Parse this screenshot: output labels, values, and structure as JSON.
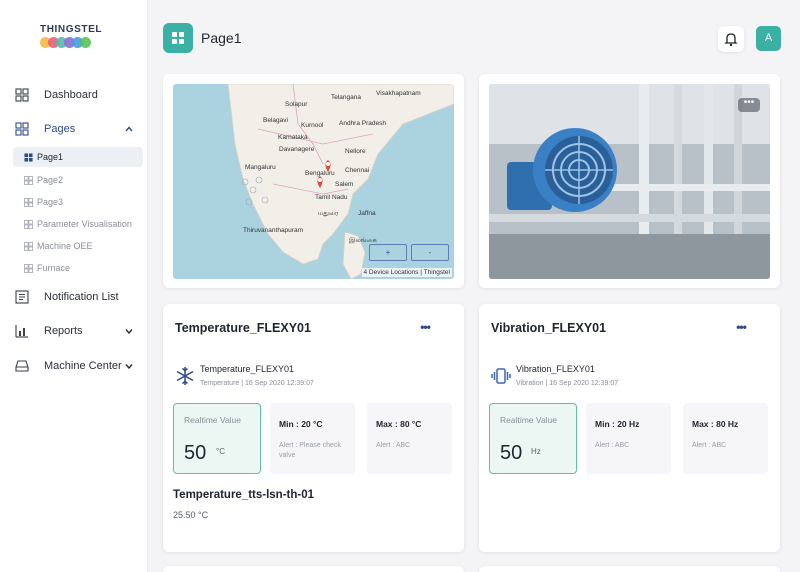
{
  "brand": {
    "name": "THINGSTEL",
    "dot_colors": [
      "#f5b942",
      "#e8617a",
      "#55b8a9",
      "#8d6bd0",
      "#4a9be0",
      "#5ac05a"
    ]
  },
  "sidebar": {
    "items": [
      {
        "label": "Dashboard",
        "icon": "grid-icon"
      },
      {
        "label": "Pages",
        "icon": "grid-icon",
        "expanded": true
      },
      {
        "label": "Notification List",
        "icon": "list-icon"
      },
      {
        "label": "Reports",
        "icon": "bar-chart-icon"
      },
      {
        "label": "Machine Center",
        "icon": "tray-icon"
      }
    ],
    "pages": [
      {
        "label": "Page1",
        "active": true
      },
      {
        "label": "Page2"
      },
      {
        "label": "Page3"
      },
      {
        "label": "Parameter Visualisation"
      },
      {
        "label": "Machine OEE"
      },
      {
        "label": "Furnace"
      }
    ]
  },
  "header": {
    "title": "Page1",
    "avatar_initial": "A"
  },
  "map": {
    "attribution": "4 Device Locations | Thingstel",
    "labels": [
      "Solapur",
      "Telangana",
      "Visakhapatnam",
      "Belagavi",
      "Kurnool",
      "Karnataka",
      "Andhra Pradesh",
      "Davanagere",
      "Nellore",
      "Mangaluru",
      "Bengaluru",
      "Chennai",
      "Salem",
      "Tamil Nadu",
      "Thiruvananthapuram",
      "மதுரை",
      "Jaffna",
      "இலங்கை"
    ],
    "zoom_in": "+",
    "zoom_out": "-"
  },
  "photo": {
    "more": "•••"
  },
  "widgets": [
    {
      "title": "Temperature_FLEXY01",
      "more": "•••",
      "sensor_name": "Temperature_FLEXY01",
      "sensor_meta": "Temperature | 16 Sep 2020 12:39:07",
      "realtime_label": "Realtime Value",
      "realtime_value": "50",
      "unit": "°C",
      "min_label": "Min : 20 °C",
      "min_sub": "Alert : Please check valve",
      "max_label": "Max : 80 °C",
      "max_sub": "Alert : ABC",
      "extra_title": "Temperature_tts-lsn-th-01",
      "extra_value": "25.50 °C"
    },
    {
      "title": "Vibration_FLEXY01",
      "more": "•••",
      "sensor_name": "Vibration_FLEXY01",
      "sensor_meta": "Vibration | 16 Sep 2020 12:39:07",
      "realtime_label": "Realtime Value",
      "realtime_value": "50",
      "unit": "Hz",
      "min_label": "Min : 20 Hz",
      "min_sub": "Alert : ABC",
      "max_label": "Max : 80 Hz",
      "max_sub": "Alert : ABC"
    }
  ],
  "colors": {
    "accent": "#3bb0a5",
    "snow_icon": "#2f4a8a",
    "vibration_icon": "#3a66c4"
  }
}
